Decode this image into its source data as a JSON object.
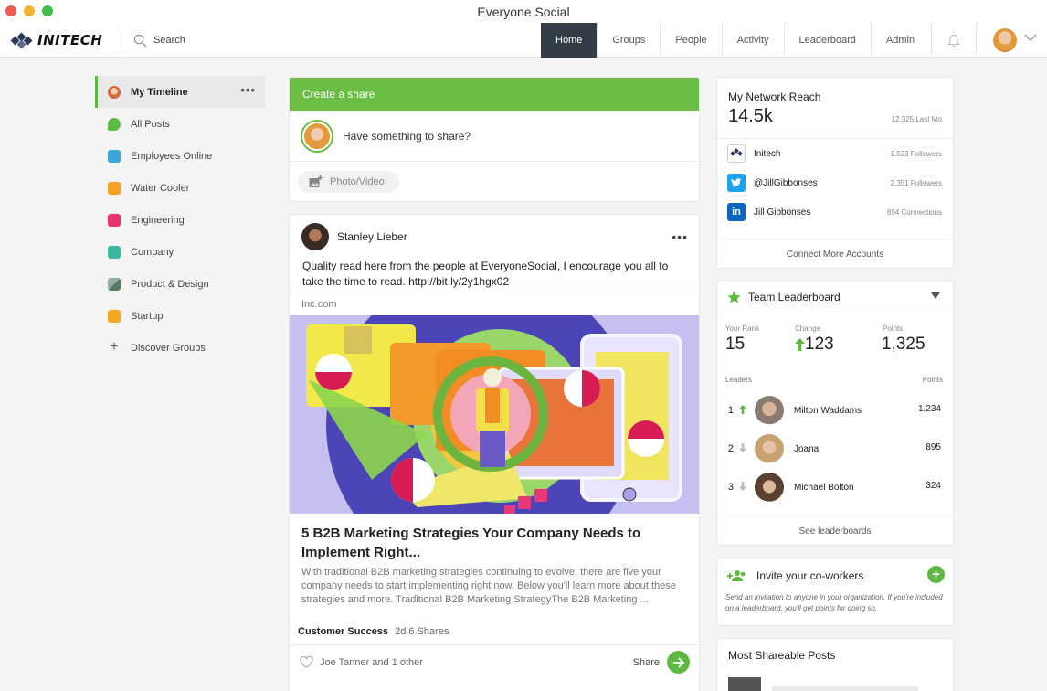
{
  "window": {
    "title": "Everyone Social"
  },
  "brand": {
    "logo_text": "INITECH",
    "accent": "#6cbd45",
    "nav_active_bg": "#333d47"
  },
  "search": {
    "label": "Search"
  },
  "nav": {
    "tabs": [
      {
        "label": "Home",
        "active": true
      },
      {
        "label": "Groups",
        "active": false
      },
      {
        "label": "People",
        "active": false
      },
      {
        "label": "Activity",
        "active": false
      },
      {
        "label": "Leaderboard",
        "active": false
      },
      {
        "label": "Admin",
        "active": false
      }
    ]
  },
  "sidebar": {
    "items": [
      {
        "label": "My Timeline",
        "icon": "user-avatar-icon",
        "color": "#e0a070",
        "active": true
      },
      {
        "label": "All Posts",
        "icon": "speech-bubble-icon",
        "color": "#5fb840"
      },
      {
        "label": "Employees Online",
        "icon": "calendar-icon",
        "color": "#3aa5d8"
      },
      {
        "label": "Water Cooler",
        "icon": "code-icon",
        "color": "#f5a020"
      },
      {
        "label": "Engineering",
        "icon": "gear-icon",
        "color": "#e8336d"
      },
      {
        "label": "Company",
        "icon": "company-badge-icon",
        "color": "#3bb8a0"
      },
      {
        "label": "Product & Design",
        "icon": "image-icon",
        "color": "#7a8a80"
      },
      {
        "label": "Startup",
        "icon": "heart-icon",
        "color": "#f5a623"
      },
      {
        "label": "Discover Groups",
        "icon": "plus-icon",
        "color": "#666666"
      }
    ]
  },
  "create_share": {
    "header": "Create a share",
    "prompt": "Have something to share?",
    "photo_label": "Photo/Video"
  },
  "post": {
    "author": "Stanley Lieber",
    "text": "Quality read here from the people at EveryoneSocial, I encourage you all to take the time to read. http://bit.ly/2y1hgx02",
    "source": "Inc.com",
    "title": "5 B2B Marketing Strategies Your Company Needs to Implement Right...",
    "excerpt": "With traditional B2B marketing strategies continuing to evolve, there are five your company needs to start implementing right now. Below you'll learn more about these strategies and more. Traditional B2B Marketing StrategyThe B2B Marketing ...",
    "group": "Customer Success",
    "age": "2d",
    "shares": "6 Shares",
    "likes": "Joe Tanner and 1 other",
    "share_label": "Share"
  },
  "reach": {
    "title": "My Network Reach",
    "value": "14.5k",
    "last": "12,325 Last Mo.",
    "accounts": [
      {
        "name": "Initech",
        "count": "1,523 Followers",
        "icon": "initech-logo-icon",
        "color": "#ffffff"
      },
      {
        "name": "@JillGibbonses",
        "count": "2,351 Followers",
        "icon": "twitter-icon",
        "color": "#1da1f2"
      },
      {
        "name": "Jill Gibbonses",
        "count": "894 Connections",
        "icon": "linkedin-icon",
        "color": "#0a66c2"
      }
    ],
    "connect_label": "Connect More Accounts"
  },
  "leaderboard": {
    "title": "Team Leaderboard",
    "rank_label": "Your Rank",
    "rank": "15",
    "change_label": "Change",
    "change": "123",
    "points_label": "Points",
    "points": "1,325",
    "leaders_label": "Leaders",
    "points_col_label": "Points",
    "leaders": [
      {
        "rank": "1",
        "name": "Milton Waddams",
        "points": "1,234",
        "trend": "up"
      },
      {
        "rank": "2",
        "name": "Joana",
        "points": "895",
        "trend": "down"
      },
      {
        "rank": "3",
        "name": "Michael Bolton",
        "points": "324",
        "trend": "down"
      }
    ],
    "see_label": "See leaderboards"
  },
  "invite": {
    "title": "Invite your co-workers",
    "desc": "Send an invitation to anyone in your organization. If you're included on a leaderboard, you'll get points for doing so."
  },
  "most_shareable": {
    "title": "Most Shareable Posts"
  }
}
